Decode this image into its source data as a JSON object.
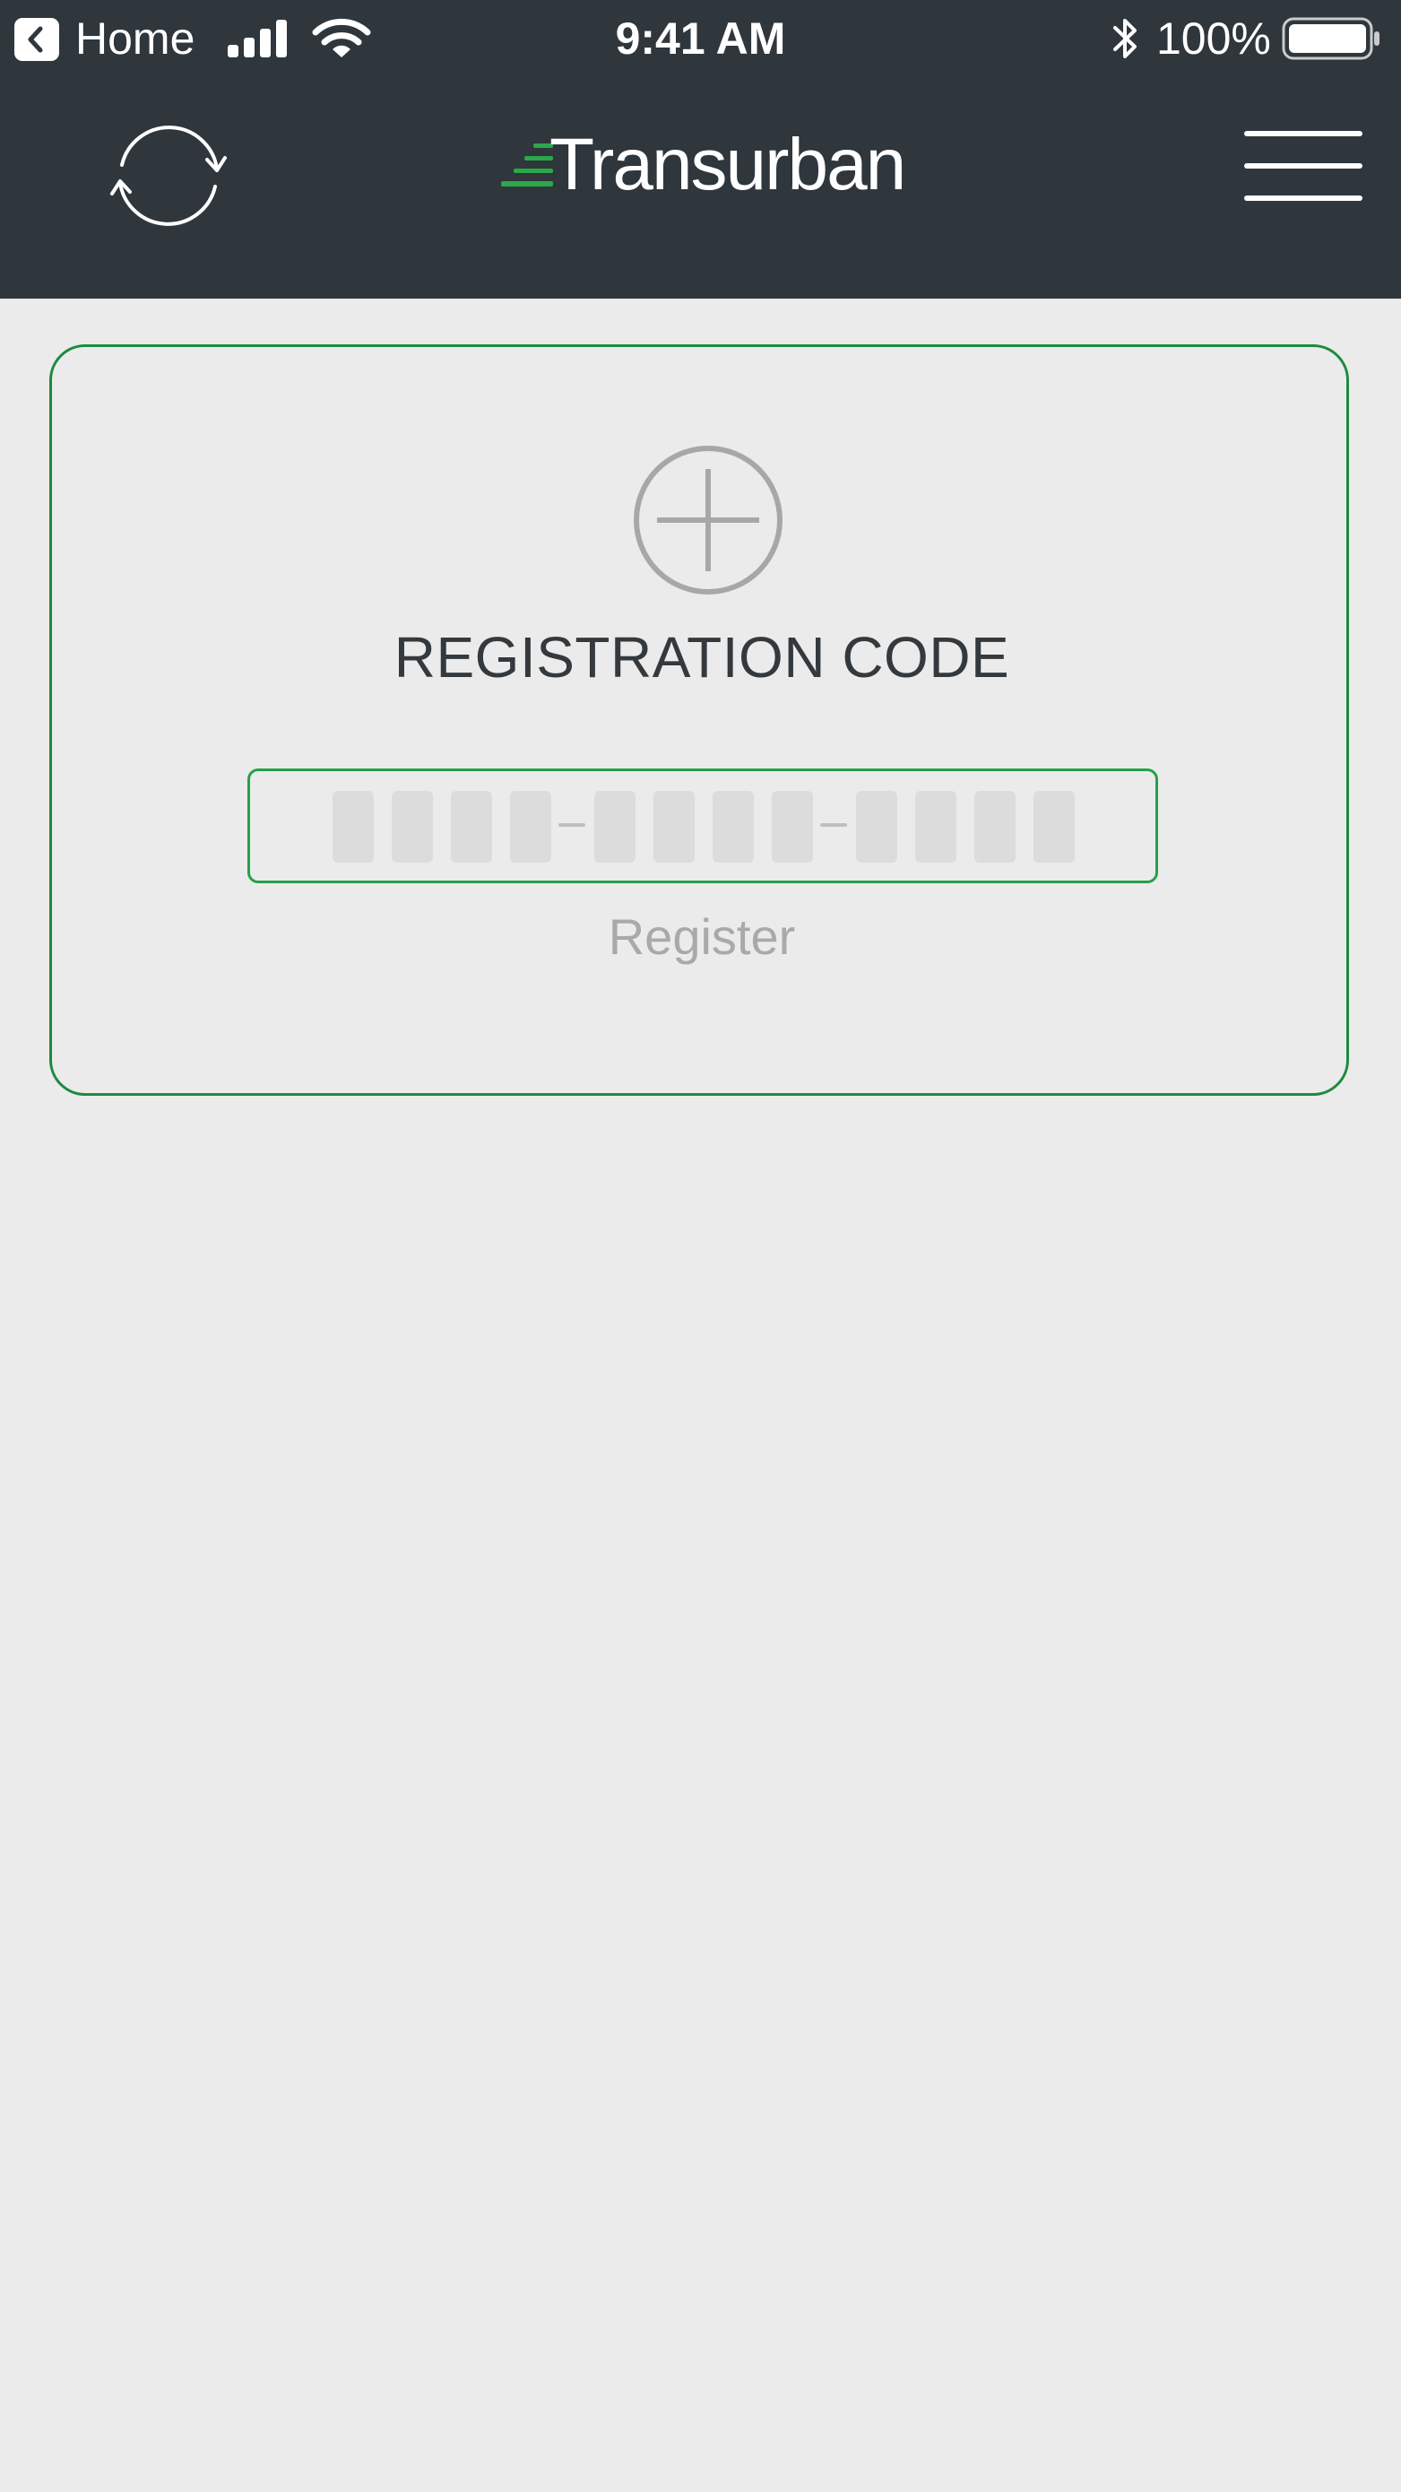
{
  "status_bar": {
    "back_app_label": "Home",
    "time": "9:41 AM",
    "battery_percent": "100%"
  },
  "header": {
    "logo_text": "Transurban",
    "refresh_icon": "refresh-icon",
    "menu_icon": "hamburger-menu-icon"
  },
  "registration": {
    "add_icon": "plus-circle-icon",
    "title": "REGISTRATION CODE",
    "code_value": "",
    "code_groups": [
      4,
      4,
      4
    ],
    "register_label": "Register"
  },
  "colors": {
    "header_bg": "#2f363c",
    "page_bg": "#ebebeb",
    "accent_green": "#26a04a",
    "title_text": "#34393d",
    "disabled_text": "#a9a9a9"
  }
}
